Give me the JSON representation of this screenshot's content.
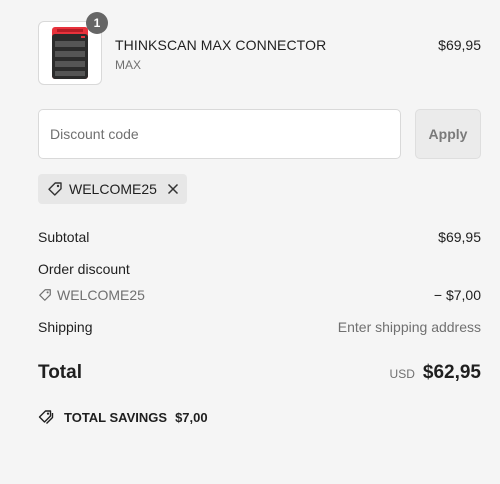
{
  "line_item": {
    "quantity": "1",
    "name": "THINKSCAN MAX CONNECTOR",
    "variant": "MAX",
    "price": "$69,95"
  },
  "discount": {
    "placeholder": "Discount code",
    "value": "",
    "apply_label": "Apply",
    "applied_code": "WELCOME25"
  },
  "summary": {
    "subtotal_label": "Subtotal",
    "subtotal_value": "$69,95",
    "order_discount_label": "Order discount",
    "order_discount_code": "WELCOME25",
    "order_discount_value": "− $7,00",
    "shipping_label": "Shipping",
    "shipping_value": "Enter shipping address",
    "total_label": "Total",
    "total_currency": "USD",
    "total_value": "$62,95",
    "savings_label": "TOTAL SAVINGS",
    "savings_value": "$7,00"
  },
  "icons": {
    "product": "obd-connector-image",
    "tag": "tag-icon",
    "remove": "close-icon",
    "savings": "tags-icon"
  },
  "colors": {
    "background": "#f5f5f5",
    "badge": "#666666",
    "product_red": "#e8323c"
  }
}
